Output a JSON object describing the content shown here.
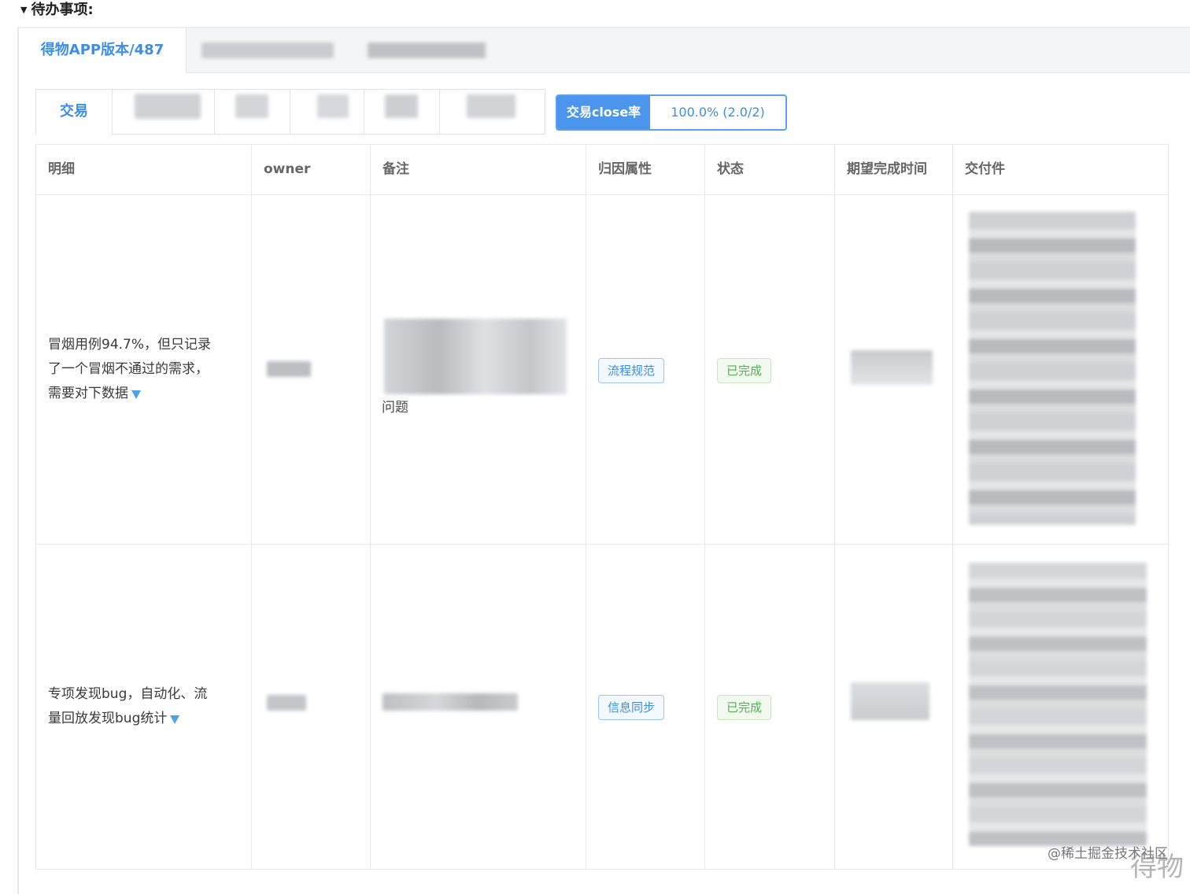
{
  "section": {
    "title": "待办事项:"
  },
  "tabs": {
    "active_label": "得物APP版本/487"
  },
  "subtabs": {
    "active_label": "交易"
  },
  "metric": {
    "label": "交易close率",
    "value": "100.0% (2.0/2)"
  },
  "table": {
    "headers": [
      "明细",
      "owner",
      "备注",
      "归因属性",
      "状态",
      "期望完成时间",
      "交付件"
    ],
    "rows": [
      {
        "detail_lines": [
          "冒烟用例94.7%，但只记录",
          "了一个冒烟不通过的需求，",
          "需要对下数据"
        ],
        "note_tail": "问题",
        "attribution": "流程规范",
        "status": "已完成"
      },
      {
        "detail_lines": [
          "专项发现bug，自动化、流",
          "量回放发现bug统计"
        ],
        "attribution": "信息同步",
        "status": "已完成"
      }
    ]
  },
  "colors": {
    "accent": "#3c8ee8",
    "done_green": "#52b152"
  },
  "watermark": {
    "community": "@稀土掘金技术社区",
    "brand": "得物"
  }
}
